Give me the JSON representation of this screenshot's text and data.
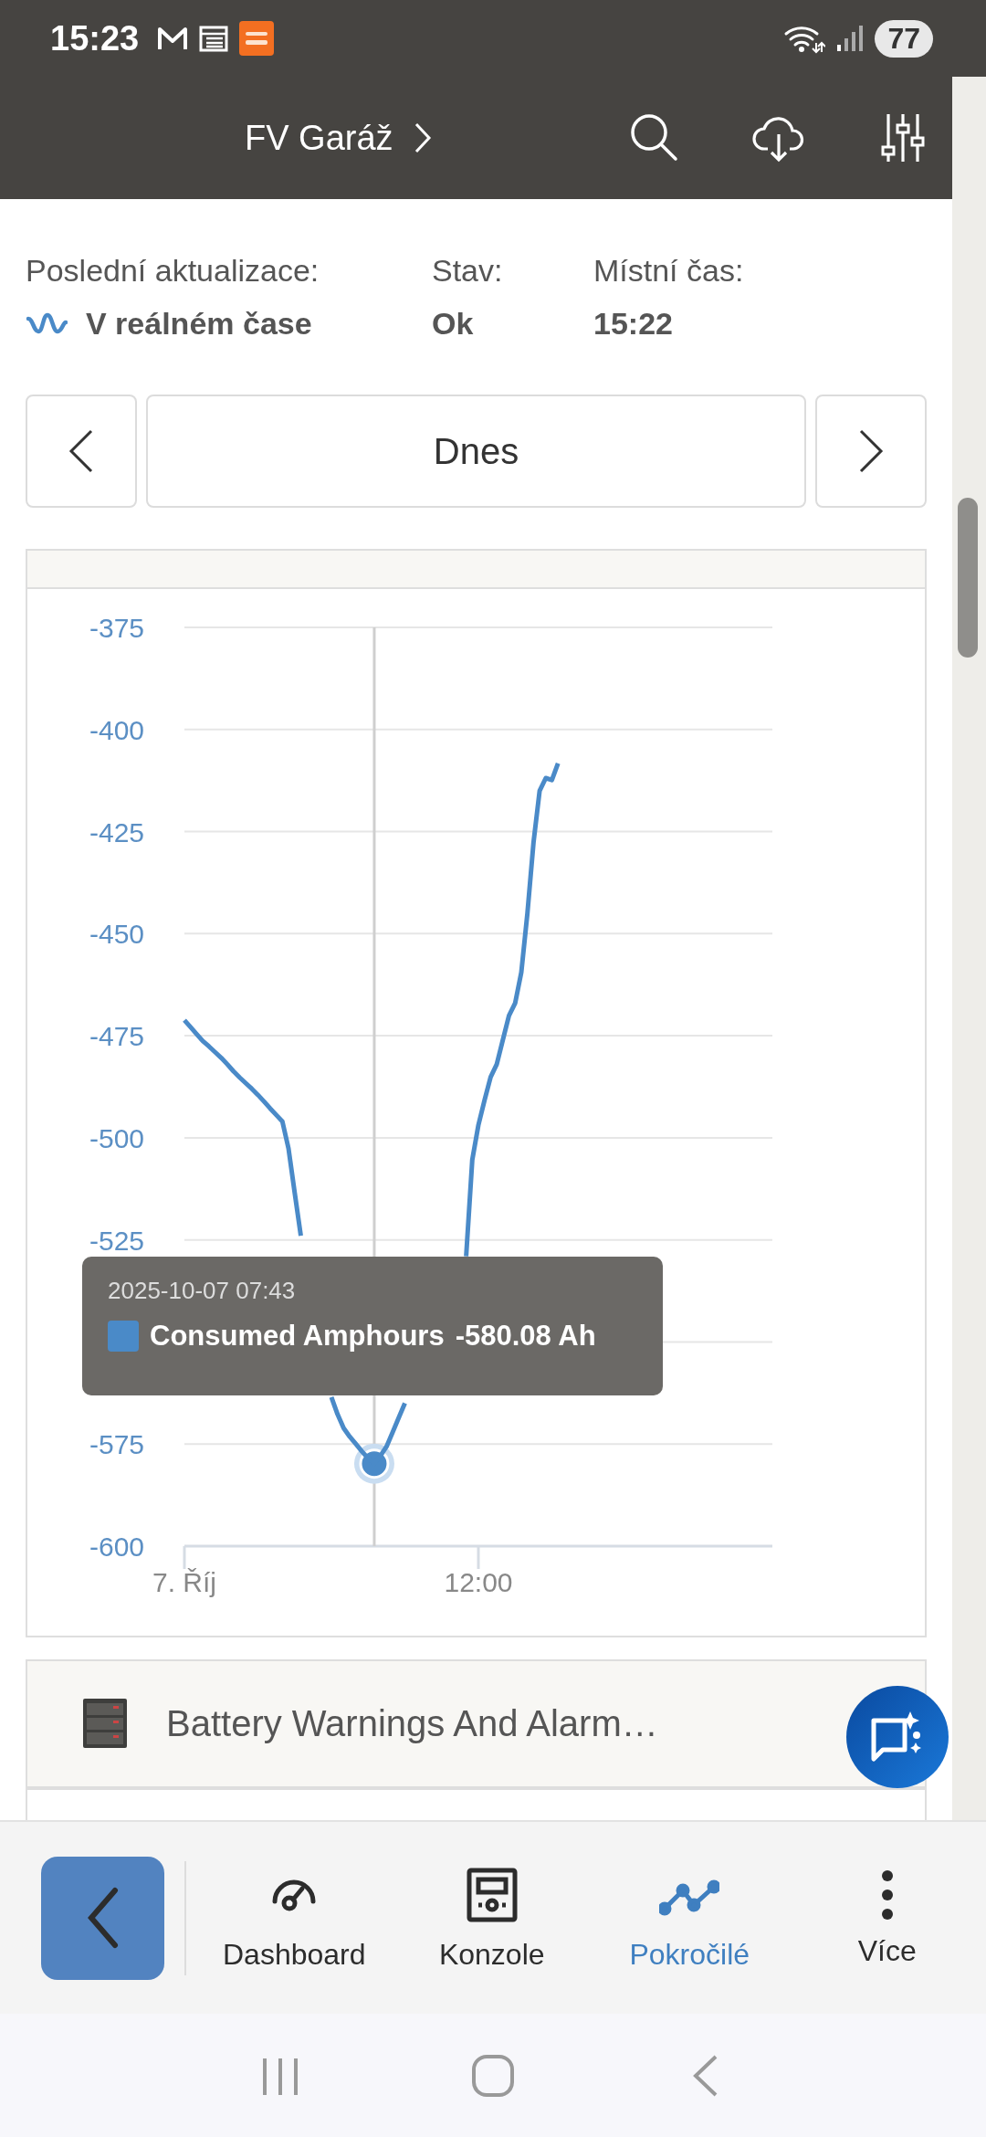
{
  "status_bar": {
    "time": "15:23",
    "battery": "77"
  },
  "header": {
    "title": "FV Garáž"
  },
  "info": [
    {
      "label": "Poslední aktualizace:",
      "value": "V reálném čase",
      "kind": "live"
    },
    {
      "label": "Stav:",
      "value": "Ok",
      "kind": "plain"
    },
    {
      "label": "Místní čas:",
      "value": "15:22",
      "kind": "plain"
    }
  ],
  "date_nav": {
    "label": "Dnes"
  },
  "chart": {
    "chart_data": {
      "type": "line",
      "categories": [
        "7. Říj",
        null,
        null,
        null,
        null,
        null,
        null,
        null,
        null,
        null,
        null,
        null,
        null,
        null,
        null,
        null,
        null,
        null,
        null,
        null,
        null,
        null,
        null,
        null,
        null,
        null,
        null,
        null,
        null,
        null,
        null,
        null,
        null,
        null,
        null,
        null,
        null,
        null,
        null,
        null,
        null,
        null,
        null,
        null,
        null,
        null,
        null,
        null,
        "12:00",
        null,
        null,
        null,
        null,
        null,
        null,
        null,
        null,
        null,
        null,
        null,
        null,
        null,
        null,
        null,
        null,
        null,
        null,
        null,
        null,
        null,
        null,
        null,
        null,
        null,
        null,
        null,
        null,
        null,
        null,
        null,
        null,
        null,
        null,
        null,
        null,
        null,
        null,
        null,
        null,
        null,
        null,
        null,
        null,
        null,
        null,
        null,
        null
      ],
      "series": [
        {
          "name": "Consumed Amphours",
          "color": "#4a8ac8",
          "values": [
            -471.2,
            -472.9,
            -474.6,
            -476.3,
            -477.6,
            -479.0,
            -480.4,
            -482.0,
            -483.7,
            -485.2,
            -486.6,
            -488.0,
            -489.5,
            -491.1,
            -492.8,
            -494.4,
            -496.0,
            -502.6,
            -513.5,
            -524.0,
            null,
            null,
            null,
            null,
            -563.5,
            -567.7,
            -571.1,
            -573.2,
            -575.0,
            -576.8,
            -578.5,
            -579.8,
            -577.9,
            -575.6,
            -572.1,
            -568.5,
            -565,
            null,
            null,
            null,
            null,
            null,
            null,
            null,
            null,
            null,
            -529,
            -505.4,
            -496.9,
            -490.8,
            -485.1,
            -482.0,
            -476.0,
            -470.1,
            -467.0,
            -459.5,
            -445.0,
            -427.6,
            -415.0,
            -411.9,
            -412.4,
            -408.3,
            null,
            null,
            null,
            null,
            null,
            null,
            null,
            null,
            null,
            null,
            null,
            null,
            null,
            null,
            null,
            null,
            null,
            null,
            null,
            null,
            null,
            null,
            null,
            null,
            null,
            null,
            null,
            null,
            null,
            null,
            null,
            null,
            null,
            null,
            null
          ]
        }
      ],
      "ylim": [
        -600,
        -375
      ],
      "yticks": [
        -375,
        -400,
        -425,
        -450,
        -475,
        -500,
        -525,
        -575,
        -600
      ],
      "grid": true
    },
    "tooltip": {
      "time": "2025-10-07 07:43",
      "value": "-580.08 Ah"
    }
  },
  "panels": [
    {
      "title": "Battery Warnings And Alarm…"
    }
  ],
  "bottom_nav": [
    {
      "label": "Dashboard",
      "kind": "gauge",
      "selected": false
    },
    {
      "label": "Konzole",
      "kind": "console",
      "selected": false
    },
    {
      "label": "Pokročilé",
      "kind": "chart",
      "selected": true
    },
    {
      "label": "Více",
      "kind": "more",
      "selected": false
    }
  ]
}
